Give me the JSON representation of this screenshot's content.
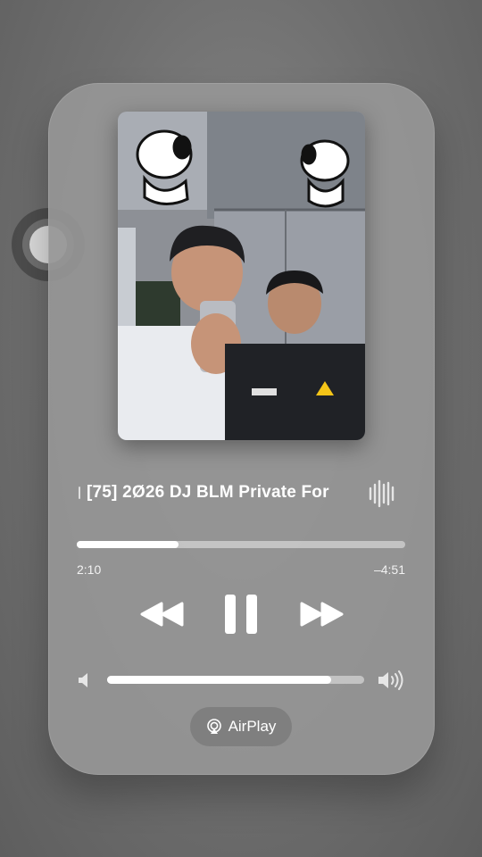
{
  "now_playing": {
    "title": "[75] 2Ø26 DJ BLM Private For",
    "progress_fraction": 0.31,
    "elapsed": "2:10",
    "remaining": "–4:51",
    "volume_fraction": 0.87,
    "is_playing": true
  },
  "controls": {
    "rewind_icon": "rewind-icon",
    "pause_icon": "pause-icon",
    "forward_icon": "fast-forward-icon"
  },
  "airplay": {
    "label": "AirPlay",
    "icon": "airplay-icon"
  },
  "colors": {
    "background": "#6f6f6f",
    "panel": "#969696",
    "foreground": "#ffffff"
  }
}
